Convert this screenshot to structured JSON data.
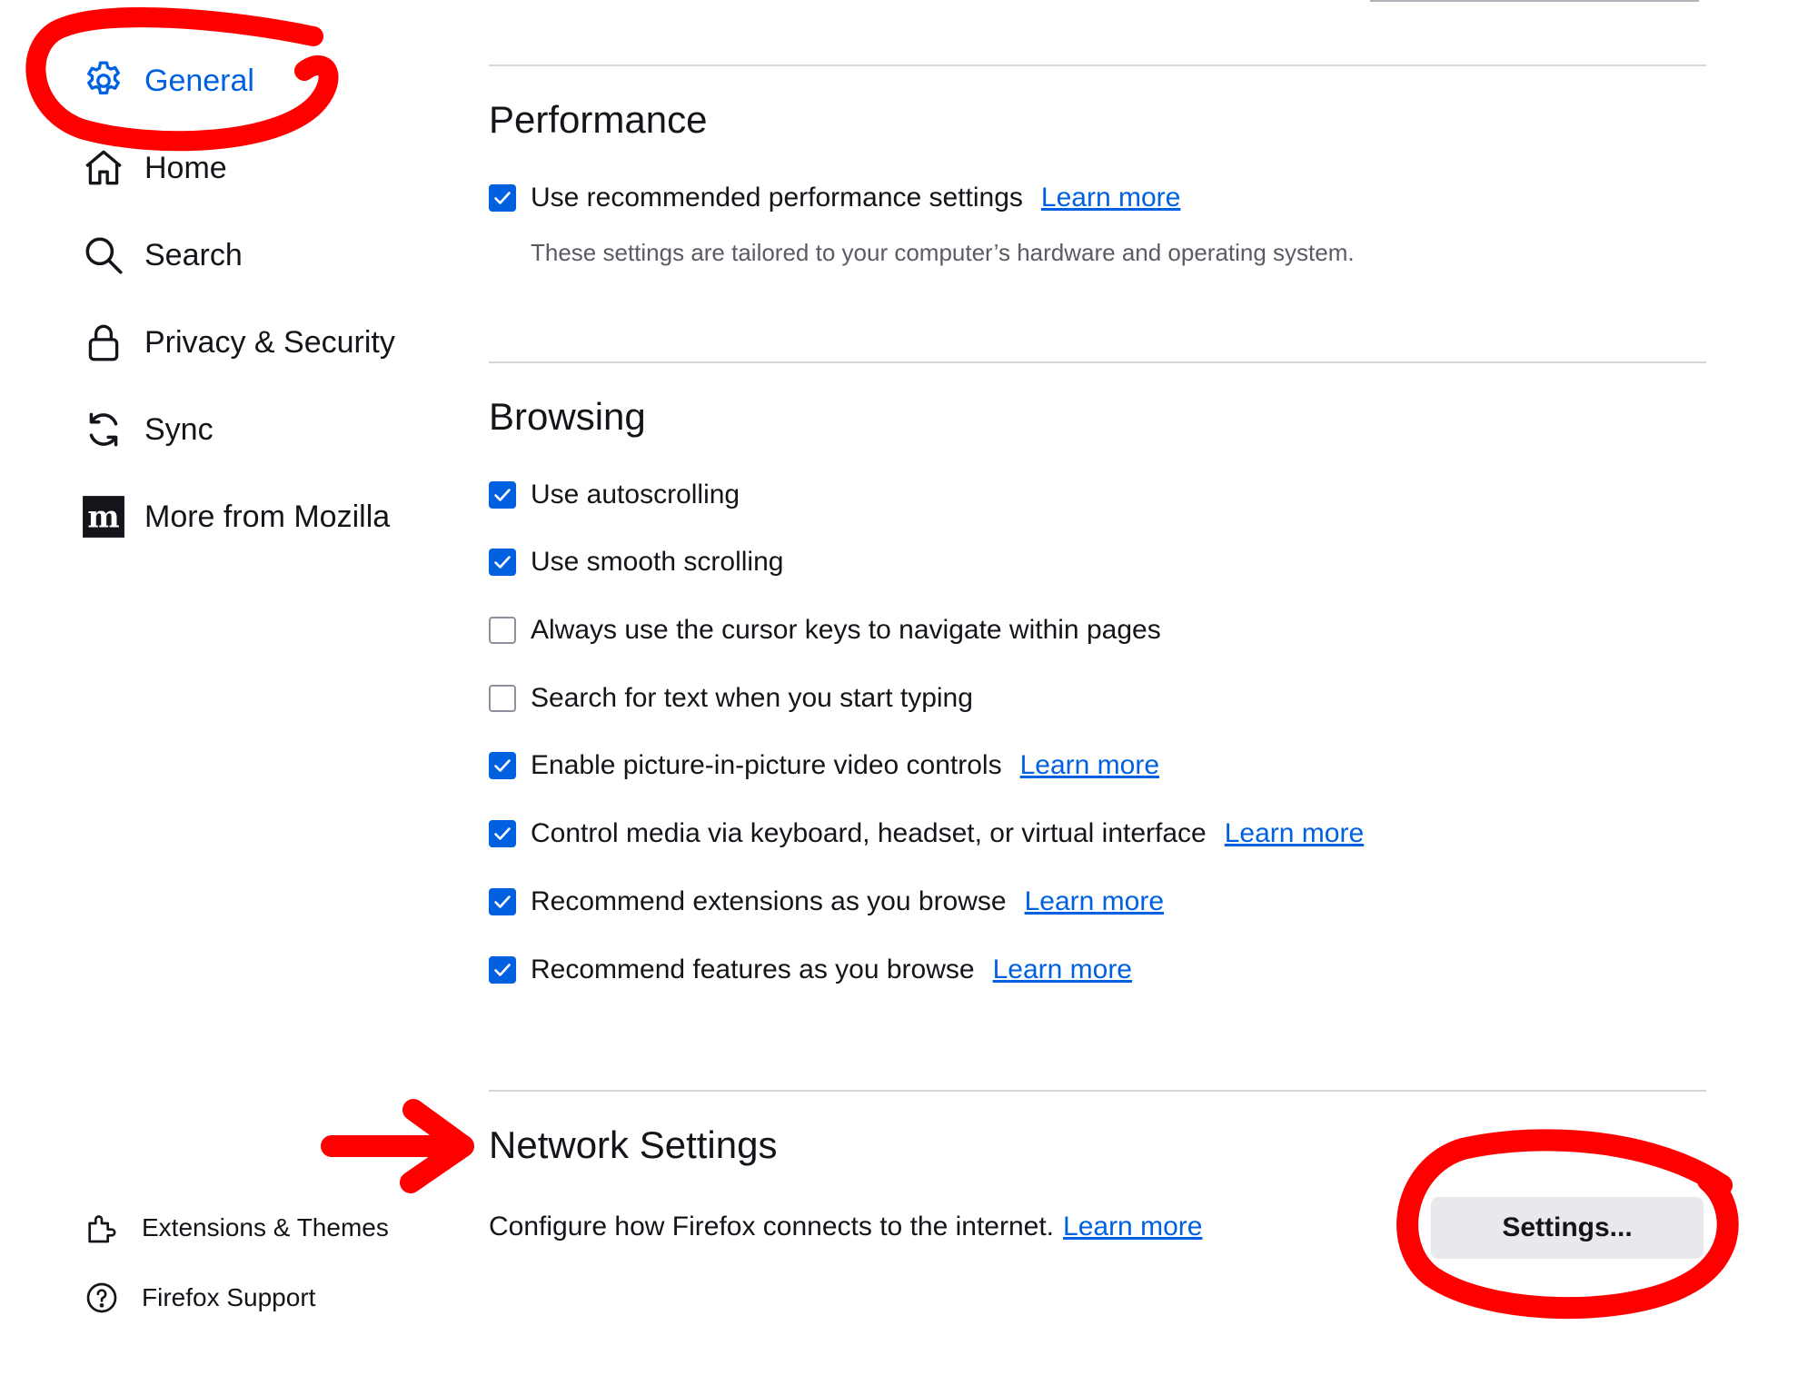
{
  "sidebar": {
    "items": [
      {
        "label": "General",
        "icon": "gear-icon",
        "active": true
      },
      {
        "label": "Home",
        "icon": "home-icon"
      },
      {
        "label": "Search",
        "icon": "search-icon"
      },
      {
        "label": "Privacy & Security",
        "icon": "lock-icon"
      },
      {
        "label": "Sync",
        "icon": "sync-icon"
      },
      {
        "label": "More from Mozilla",
        "icon": "mozilla-icon"
      }
    ],
    "footer": [
      {
        "label": "Extensions & Themes",
        "icon": "puzzle-icon"
      },
      {
        "label": "Firefox Support",
        "icon": "help-icon"
      }
    ]
  },
  "performance": {
    "heading": "Performance",
    "recommended": {
      "label": "Use recommended performance settings",
      "checked": true,
      "link": "Learn more"
    },
    "description": "These settings are tailored to your computer’s hardware and operating system."
  },
  "browsing": {
    "heading": "Browsing",
    "options": [
      {
        "label": "Use autoscrolling",
        "checked": true
      },
      {
        "label": "Use smooth scrolling",
        "checked": true
      },
      {
        "label": "Always use the cursor keys to navigate within pages",
        "checked": false
      },
      {
        "label": "Search for text when you start typing",
        "checked": false
      },
      {
        "label": "Enable picture-in-picture video controls",
        "checked": true,
        "link": "Learn more"
      },
      {
        "label": "Control media via keyboard, headset, or virtual interface",
        "checked": true,
        "link": "Learn more"
      },
      {
        "label": "Recommend extensions as you browse",
        "checked": true,
        "link": "Learn more"
      },
      {
        "label": "Recommend features as you browse",
        "checked": true,
        "link": "Learn more"
      }
    ]
  },
  "network": {
    "heading": "Network Settings",
    "description": "Configure how Firefox connects to the internet.",
    "link": "Learn more",
    "button": "Settings..."
  },
  "colors": {
    "accent": "#0061e0",
    "annotation": "#ff0000",
    "button_bg": "#e9e9ed"
  }
}
